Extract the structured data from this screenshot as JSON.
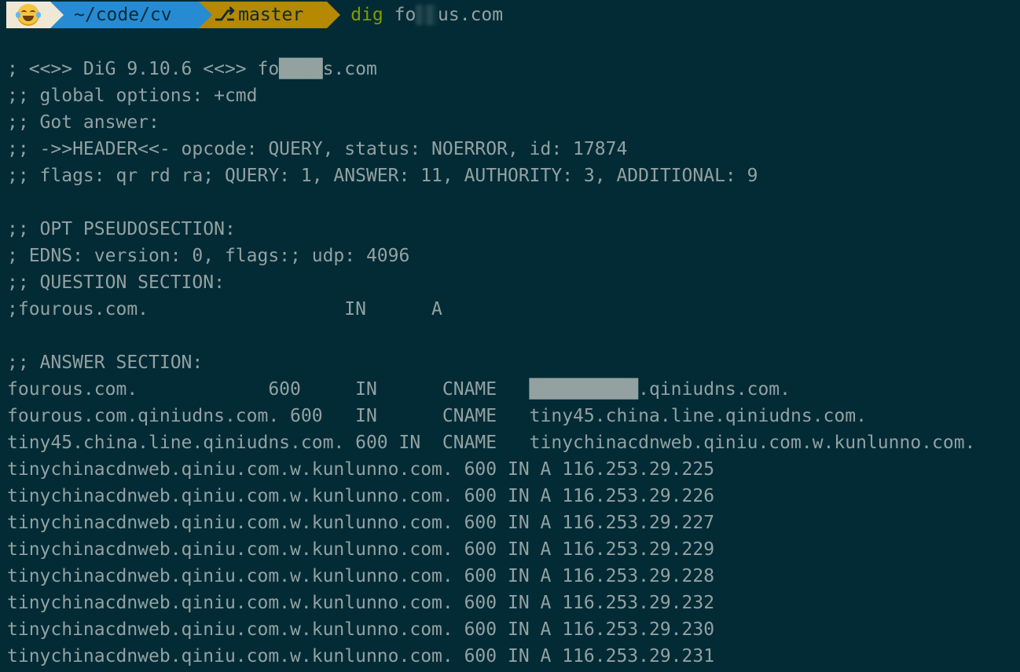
{
  "prompt": {
    "emoji": "crying-laughing-emoji",
    "path": "~/code/cv",
    "branch_icon": "⎇",
    "branch": "master",
    "command": "dig",
    "argument_visible_prefix": "fo",
    "argument_visible_suffix": "us.com"
  },
  "output": {
    "lines": [
      "; <<>> DiG 9.10.6 <<>> fo████s.com",
      ";; global options: +cmd",
      ";; Got answer:",
      ";; ->>HEADER<<- opcode: QUERY, status: NOERROR, id: 17874",
      ";; flags: qr rd ra; QUERY: 1, ANSWER: 11, AUTHORITY: 3, ADDITIONAL: 9",
      "",
      ";; OPT PSEUDOSECTION:",
      "; EDNS: version: 0, flags:; udp: 4096",
      ";; QUESTION SECTION:",
      ";fourous.com.                  IN      A",
      "",
      ";; ANSWER SECTION:",
      "fourous.com.            600     IN      CNAME   ██████████.qiniudns.com.",
      "fourous.com.qiniudns.com. 600   IN      CNAME   tiny45.china.line.qiniudns.com.",
      "tiny45.china.line.qiniudns.com. 600 IN  CNAME   tinychinacdnweb.qiniu.com.w.kunlunno.com.",
      "tinychinacdnweb.qiniu.com.w.kunlunno.com. 600 IN A 116.253.29.225",
      "tinychinacdnweb.qiniu.com.w.kunlunno.com. 600 IN A 116.253.29.226",
      "tinychinacdnweb.qiniu.com.w.kunlunno.com. 600 IN A 116.253.29.227",
      "tinychinacdnweb.qiniu.com.w.kunlunno.com. 600 IN A 116.253.29.229",
      "tinychinacdnweb.qiniu.com.w.kunlunno.com. 600 IN A 116.253.29.228",
      "tinychinacdnweb.qiniu.com.w.kunlunno.com. 600 IN A 116.253.29.232",
      "tinychinacdnweb.qiniu.com.w.kunlunno.com. 600 IN A 116.253.29.230",
      "tinychinacdnweb.qiniu.com.w.kunlunno.com. 600 IN A 116.253.29.231"
    ]
  },
  "colors": {
    "background": "#022b36",
    "text": "#93a1a1",
    "path_segment": "#268bd2",
    "branch_segment": "#b58900",
    "command": "#859900"
  }
}
